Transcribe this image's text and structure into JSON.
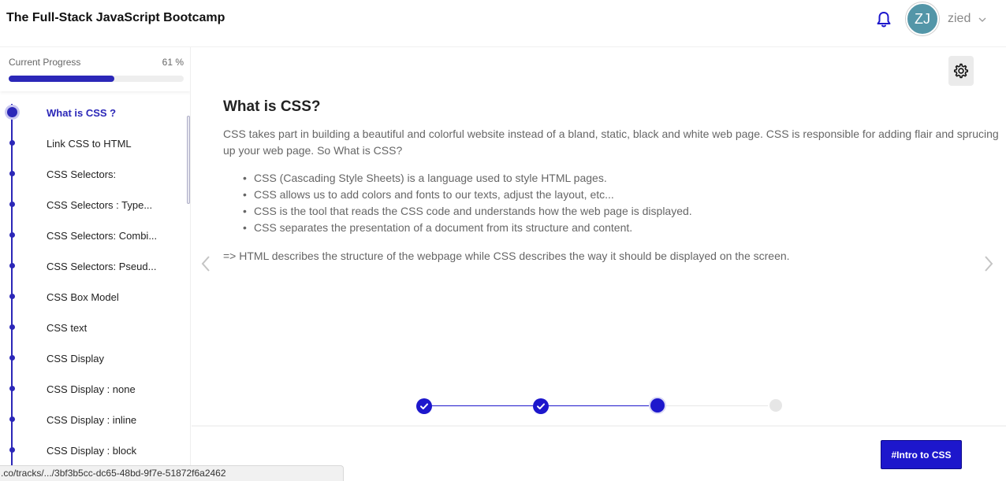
{
  "header": {
    "title": "The Full-Stack JavaScript Bootcamp",
    "avatar_initials": "ZJ",
    "avatar_color": "#5396a8",
    "username": "zied",
    "icons": {
      "notifications": "bell-icon",
      "user_menu": "chevron-down-icon"
    }
  },
  "sidebar": {
    "progress_label": "Current Progress",
    "progress_percent": "61 %",
    "progress_value": 0.61,
    "accent_color": "#2b27b8",
    "lessons": [
      {
        "label": "What is CSS ?",
        "active": true
      },
      {
        "label": "Link CSS to HTML",
        "active": false
      },
      {
        "label": "CSS Selectors:",
        "active": false
      },
      {
        "label": "CSS Selectors : Type...",
        "active": false
      },
      {
        "label": "CSS Selectors: Combi...",
        "active": false
      },
      {
        "label": "CSS Selectors: Pseud...",
        "active": false
      },
      {
        "label": "CSS Box Model",
        "active": false
      },
      {
        "label": "CSS text",
        "active": false
      },
      {
        "label": "CSS Display",
        "active": false
      },
      {
        "label": "CSS Display : none",
        "active": false
      },
      {
        "label": "CSS Display : inline",
        "active": false
      },
      {
        "label": "CSS Display : block",
        "active": false
      }
    ]
  },
  "main": {
    "title": "What is CSS?",
    "intro": "CSS takes part in building a beautiful and colorful website instead of a bland, static, black and white web page. CSS is responsible for adding flair and sprucing up your web page. So What is CSS?",
    "bullets": [
      "CSS (Cascading Style Sheets) is a language used to style HTML pages.",
      "CSS allows us to add colors and fonts to our texts, adjust the layout, etc...",
      "CSS is the tool that reads the CSS code and understands how the web page is displayed.",
      "CSS separates the presentation of a document from its structure and content."
    ],
    "conclusion": "=> HTML describes the structure of the webpage while CSS describes the way it should be displayed on the screen.",
    "icons": {
      "settings": "gear-icon",
      "prev": "chevron-left-icon",
      "next": "chevron-right-icon"
    }
  },
  "stepper": {
    "steps": [
      "done",
      "done",
      "current",
      "upcoming"
    ],
    "active_color": "#1d17cc",
    "inactive_color": "#e6e6e6"
  },
  "footer": {
    "tag_button": "#Intro to CSS"
  },
  "status_bar": {
    "url": ".co/tracks/.../3bf3b5cc-dc65-48bd-9f7e-51872f6a2462"
  }
}
